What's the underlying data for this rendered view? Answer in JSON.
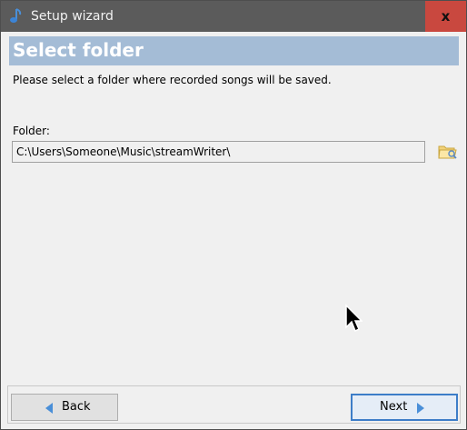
{
  "window": {
    "title": "Setup wizard",
    "close_symbol": "x"
  },
  "banner": {
    "title": "Select folder"
  },
  "instructions": "Please select a folder where recorded songs will be saved.",
  "folder": {
    "label": "Folder:",
    "value": "C:\\Users\\Someone\\Music\\streamWriter\\"
  },
  "icons": {
    "app": "music-note-icon",
    "browse": "folder-browse-icon",
    "back_arrow": "arrow-left-icon",
    "next_arrow": "arrow-right-icon",
    "cursor": "mouse-pointer-icon"
  },
  "buttons": {
    "back": "Back",
    "next": "Next"
  },
  "colors": {
    "titlebar": "#5b5b5b",
    "close": "#c9483f",
    "banner": "#a4bcd6",
    "focus_border": "#3d7dc8",
    "arrow": "#4a8fd8"
  }
}
